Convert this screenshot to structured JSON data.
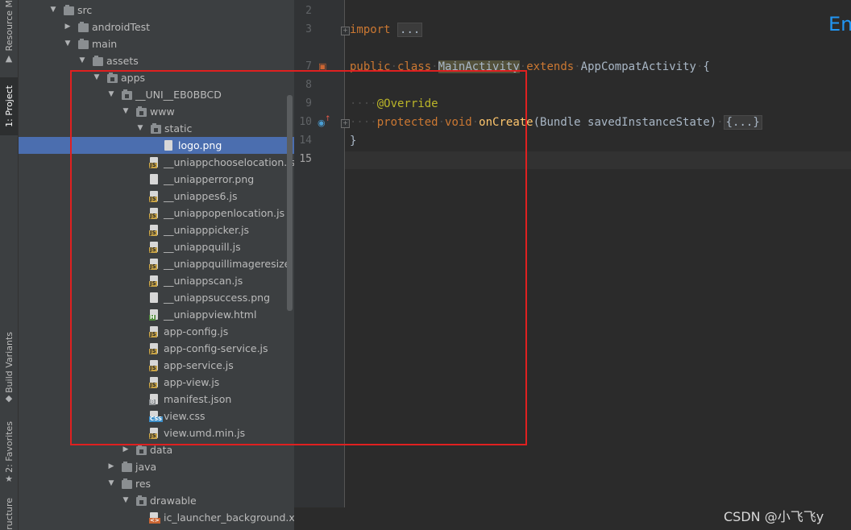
{
  "tool_windows": {
    "resource_manager": "Resource M",
    "project": "1: Project",
    "build_variants": "Build Variants",
    "favorites": "2: Favorites",
    "structure": "ructure"
  },
  "tree": [
    {
      "label": "src",
      "depth": 0,
      "arrow": "down",
      "icon": "folder"
    },
    {
      "label": "androidTest",
      "depth": 1,
      "arrow": "right",
      "icon": "folder"
    },
    {
      "label": "main",
      "depth": 1,
      "arrow": "down",
      "icon": "folder"
    },
    {
      "label": "assets",
      "depth": 2,
      "arrow": "down",
      "icon": "folder-res"
    },
    {
      "label": "apps",
      "depth": 3,
      "arrow": "down",
      "icon": "folder-pkg"
    },
    {
      "label": "__UNI__EB0BBCD",
      "depth": 4,
      "arrow": "down",
      "icon": "folder-pkg"
    },
    {
      "label": "www",
      "depth": 5,
      "arrow": "down",
      "icon": "folder-pkg"
    },
    {
      "label": "static",
      "depth": 6,
      "arrow": "down",
      "icon": "folder-pkg"
    },
    {
      "label": "logo.png",
      "depth": 7,
      "arrow": "",
      "icon": "img",
      "selected": true
    },
    {
      "label": "__uniappchooselocation.js",
      "depth": 6,
      "arrow": "",
      "icon": "js"
    },
    {
      "label": "__uniapperror.png",
      "depth": 6,
      "arrow": "",
      "icon": "img"
    },
    {
      "label": "__uniappes6.js",
      "depth": 6,
      "arrow": "",
      "icon": "js"
    },
    {
      "label": "__uniappopenlocation.js",
      "depth": 6,
      "arrow": "",
      "icon": "js"
    },
    {
      "label": "__uniapppicker.js",
      "depth": 6,
      "arrow": "",
      "icon": "js"
    },
    {
      "label": "__uniappquill.js",
      "depth": 6,
      "arrow": "",
      "icon": "js"
    },
    {
      "label": "__uniappquillimageresize.",
      "depth": 6,
      "arrow": "",
      "icon": "js"
    },
    {
      "label": "__uniappscan.js",
      "depth": 6,
      "arrow": "",
      "icon": "js"
    },
    {
      "label": "__uniappsuccess.png",
      "depth": 6,
      "arrow": "",
      "icon": "img"
    },
    {
      "label": "__uniappview.html",
      "depth": 6,
      "arrow": "",
      "icon": "html"
    },
    {
      "label": "app-config.js",
      "depth": 6,
      "arrow": "",
      "icon": "js"
    },
    {
      "label": "app-config-service.js",
      "depth": 6,
      "arrow": "",
      "icon": "js"
    },
    {
      "label": "app-service.js",
      "depth": 6,
      "arrow": "",
      "icon": "js"
    },
    {
      "label": "app-view.js",
      "depth": 6,
      "arrow": "",
      "icon": "js"
    },
    {
      "label": "manifest.json",
      "depth": 6,
      "arrow": "",
      "icon": "json"
    },
    {
      "label": "view.css",
      "depth": 6,
      "arrow": "",
      "icon": "css"
    },
    {
      "label": "view.umd.min.js",
      "depth": 6,
      "arrow": "",
      "icon": "js"
    },
    {
      "label": "data",
      "depth": 5,
      "arrow": "right",
      "icon": "folder-pkg"
    },
    {
      "label": "java",
      "depth": 4,
      "arrow": "right",
      "icon": "folder"
    },
    {
      "label": "res",
      "depth": 4,
      "arrow": "down",
      "icon": "folder-res"
    },
    {
      "label": "drawable",
      "depth": 5,
      "arrow": "down",
      "icon": "folder-pkg"
    },
    {
      "label": "ic_launcher_background.xml",
      "depth": 6,
      "arrow": "",
      "icon": "xml"
    }
  ],
  "editor": {
    "line_numbers": [
      "2",
      "3",
      "7",
      "8",
      "9",
      "10",
      "14",
      "15"
    ],
    "import_kw": "import",
    "import_fold": "...",
    "public_kw": "public",
    "class_kw": "class",
    "class_name": "MainActivity",
    "extends_kw": "extends",
    "parent": "AppCompatActivity",
    "brace_open": "{",
    "annotation": "@Override",
    "protected_kw": "protected",
    "void_kw": "void",
    "method": "onCreate",
    "params": "(Bundle savedInstanceState)",
    "method_fold": "{...}",
    "brace_close": "}",
    "corner_text": "En"
  },
  "watermark": "CSDN @小飞飞y"
}
